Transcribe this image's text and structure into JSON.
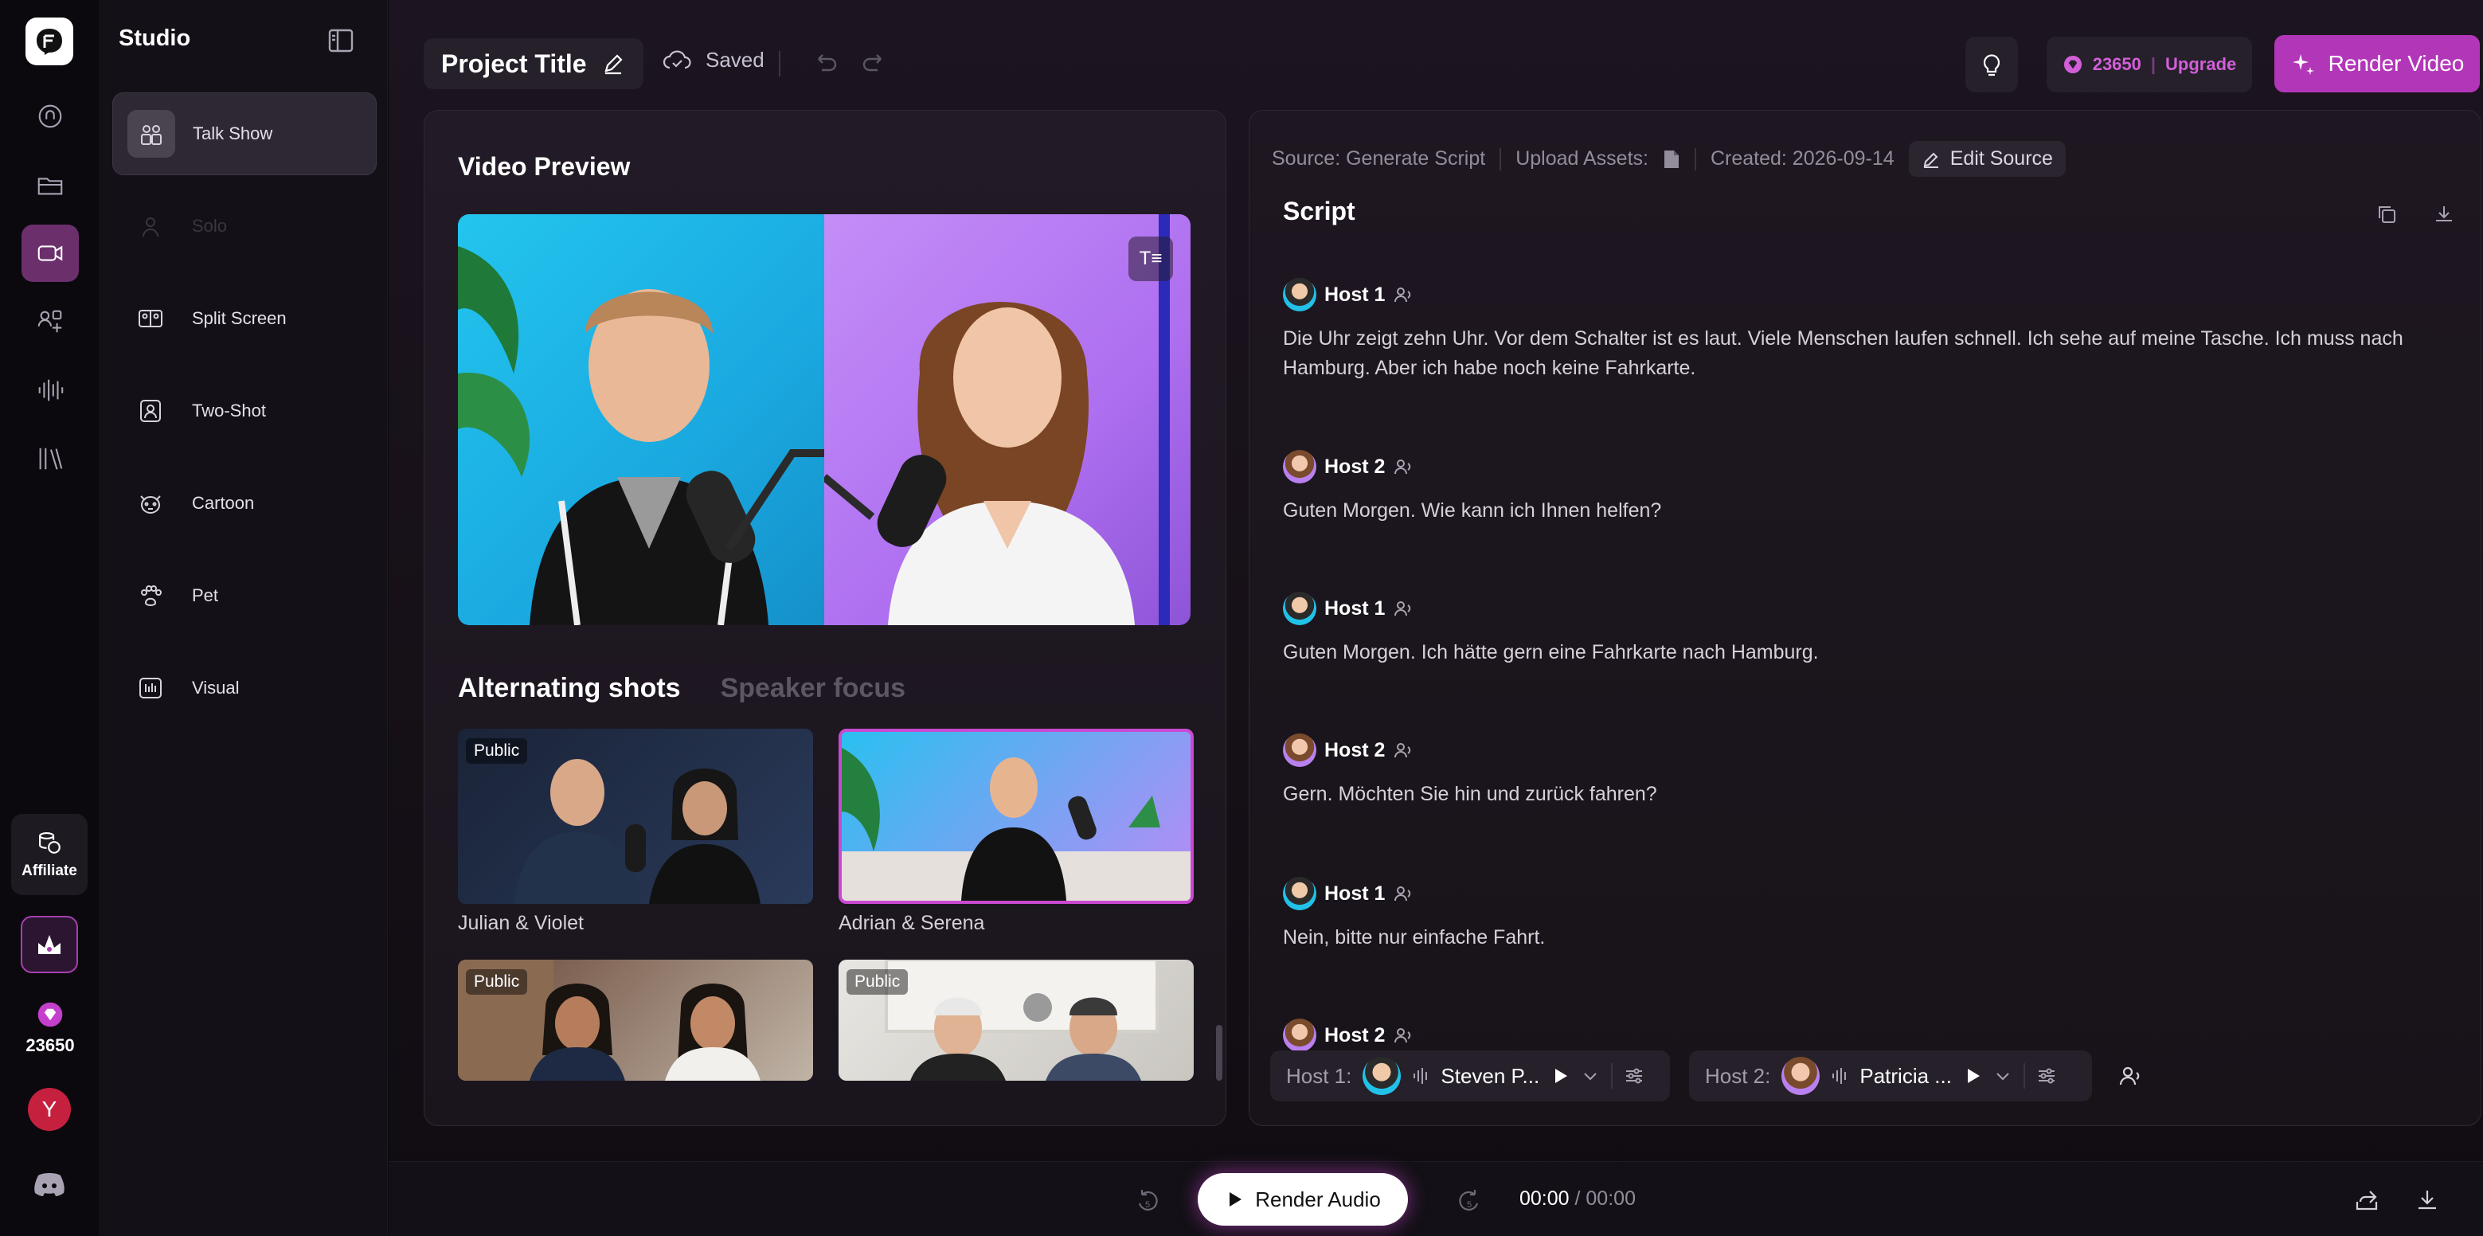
{
  "rail": {
    "credits": "23650",
    "avatar_letter": "Y",
    "affiliate_label": "Affiliate",
    "items": [
      {
        "name": "home-icon"
      },
      {
        "name": "folder-icon"
      },
      {
        "name": "video-icon"
      },
      {
        "name": "avatars-icon"
      },
      {
        "name": "audio-wave-icon"
      },
      {
        "name": "library-icon"
      }
    ]
  },
  "studio": {
    "title": "Studio",
    "items": [
      {
        "label": "Talk Show",
        "icon": "talk-show-icon",
        "active": true
      },
      {
        "label": "Solo",
        "icon": "solo-icon",
        "disabled": true
      },
      {
        "label": "Split Screen",
        "icon": "split-screen-icon"
      },
      {
        "label": "Two-Shot",
        "icon": "two-shot-icon"
      },
      {
        "label": "Cartoon",
        "icon": "cartoon-icon"
      },
      {
        "label": "Pet",
        "icon": "paw-icon"
      },
      {
        "label": "Visual",
        "icon": "visual-icon"
      }
    ]
  },
  "topbar": {
    "project_title": "Project Title",
    "saved_label": "Saved",
    "credits": "23650",
    "upgrade_label": "Upgrade",
    "render_video_label": "Render Video"
  },
  "preview": {
    "title": "Video Preview",
    "tabs": [
      "Alternating shots",
      "Speaker focus"
    ],
    "thumbnails": [
      {
        "label": "Julian & Violet",
        "badge": "Public"
      },
      {
        "label": "Adrian & Serena",
        "badge": ""
      },
      {
        "label": "",
        "badge": "Public"
      },
      {
        "label": "",
        "badge": "Public"
      }
    ]
  },
  "script": {
    "meta": {
      "source": "Source: Generate Script",
      "upload_assets": "Upload Assets:",
      "created": "Created: 2026-09-14",
      "edit_source": "Edit Source"
    },
    "title": "Script",
    "lines": [
      {
        "speaker": "Host 1",
        "text": "Die Uhr zeigt zehn Uhr. Vor dem Schalter ist es laut. Viele Menschen laufen schnell. Ich sehe auf meine Tasche. Ich muss nach Hamburg. Aber ich habe noch keine Fahrkarte."
      },
      {
        "speaker": "Host 2",
        "text": "Guten Morgen. Wie kann ich Ihnen helfen?"
      },
      {
        "speaker": "Host 1",
        "text": "Guten Morgen. Ich hätte gern eine Fahrkarte nach Hamburg."
      },
      {
        "speaker": "Host 2",
        "text": "Gern. Möchten Sie hin und zurück fahren?"
      },
      {
        "speaker": "Host 1",
        "text": "Nein, bitte nur einfache Fahrt."
      },
      {
        "speaker": "Host 2",
        "text": ""
      }
    ],
    "voices": [
      {
        "label": "Host 1:",
        "name": "Steven P..."
      },
      {
        "label": "Host 2:",
        "name": "Patricia ..."
      }
    ]
  },
  "bottombar": {
    "rewind_label": "5",
    "forward_label": "5",
    "render_audio_label": "Render Audio",
    "time_current": "00:00",
    "time_separator": " / ",
    "time_total": "00:00"
  },
  "colors": {
    "accent": "#b237b8",
    "background": "#0d0a10",
    "panel": "#1e1721"
  }
}
